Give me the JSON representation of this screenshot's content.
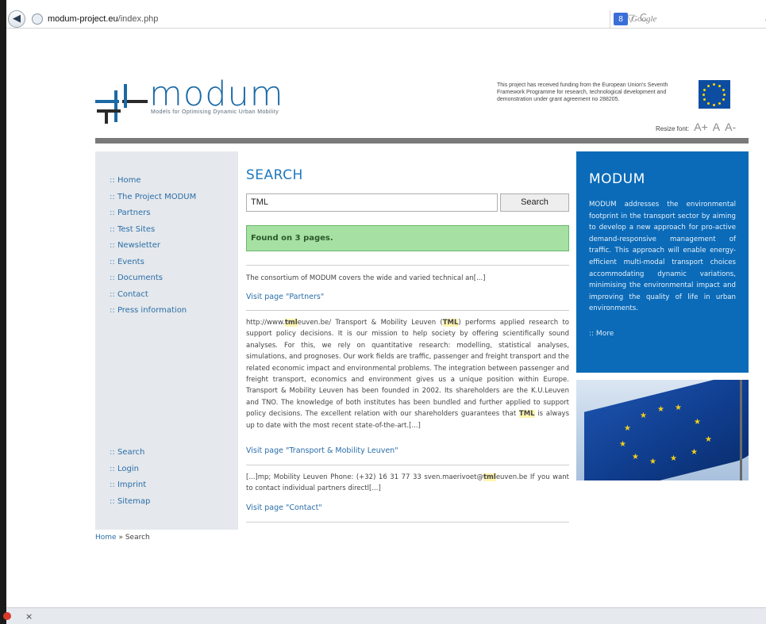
{
  "browser": {
    "url_domain": "modum-project.eu",
    "url_path": "/index.php",
    "search_engine_badge": "8",
    "search_placeholder": "Google",
    "star_glyph": "☆",
    "dropdown_glyph": "▽",
    "reload_glyph": "C",
    "back_glyph": "◀",
    "magnifier_glyph": "⌕",
    "status_close": "×"
  },
  "header": {
    "logo_word": "modum",
    "logo_subtitle": "Models for Optimising Dynamic Urban Mobility",
    "funding_text": "This project has received funding from the European Union's Seventh Framework Programme for research, technological development and demonstration under grant agreement no 288205.",
    "resize_label": "Resize font:",
    "resize_larger": "A+",
    "resize_reset": "A",
    "resize_smaller": "A-"
  },
  "sidebar": {
    "separator": "::",
    "top_items": [
      {
        "label": "Home"
      },
      {
        "label": "The Project MODUM"
      },
      {
        "label": "Partners"
      },
      {
        "label": "Test Sites"
      },
      {
        "label": "Newsletter"
      },
      {
        "label": "Events"
      },
      {
        "label": "Documents"
      },
      {
        "label": "Contact"
      },
      {
        "label": "Press information"
      }
    ],
    "bottom_items": [
      {
        "label": "Search"
      },
      {
        "label": "Login"
      },
      {
        "label": "Imprint"
      },
      {
        "label": "Sitemap"
      }
    ]
  },
  "main": {
    "title": "SEARCH",
    "search_value": "TML",
    "search_button": "Search",
    "found_message": "Found on 3 pages.",
    "results": [
      {
        "text": "The consortium of MODUM covers the wide and varied technical an[...]",
        "link": "Visit page \"Partners\""
      },
      {
        "text_parts": [
          "http://www.",
          "tml",
          "euven.be/ Transport & Mobility Leuven (",
          "TML",
          ") performs applied research to support policy decisions. It is our mission to help society by offering scientifically sound analyses. For this, we rely on quantitative research: modelling, statistical analyses, simulations, and prognoses. Our work fields are traffic, passenger and freight transport and the related economic impact and environmental problems. The integration between passenger and freight transport, economics and environment gives us a unique position within Europe. Transport & Mobility Leuven has been founded in 2002. Its shareholders are the K.U.Leuven and TNO. The knowledge of both institutes has been bundled and further applied to support policy decisions. The excellent relation with our shareholders guarantees that ",
          "TML",
          " is always up to date with the most recent state-of-the-art.[...]"
        ],
        "link": "Visit page \"Transport & Mobility Leuven\""
      },
      {
        "text_parts": [
          "[...]mp; Mobility Leuven Phone: (+32) 16 31 77 33 sven.maerivoet@",
          "tml",
          "euven.be If you want to contact individual partners directl[...]"
        ],
        "link": "Visit page \"Contact\""
      }
    ]
  },
  "info_box": {
    "title": "MODUM",
    "text": "MODUM addresses the environmental footprint in the transport sector by aiming to develop a new approach for pro-active demand-responsive management of traffic. This approach will enable energy-efficient multi-modal transport choices accommodating dynamic variations, minimising the environmental impact and improving the quality of life in urban environments.",
    "more": ":: More"
  },
  "breadcrumb": {
    "home": "Home",
    "sep": " » ",
    "current": "Search"
  },
  "colors": {
    "accent": "#2078bc",
    "info_bg": "#0b6bb8",
    "found_bg": "#a6e0a3",
    "sidebar_bg": "#e5e8ec",
    "highlight": "#fff5b0"
  }
}
